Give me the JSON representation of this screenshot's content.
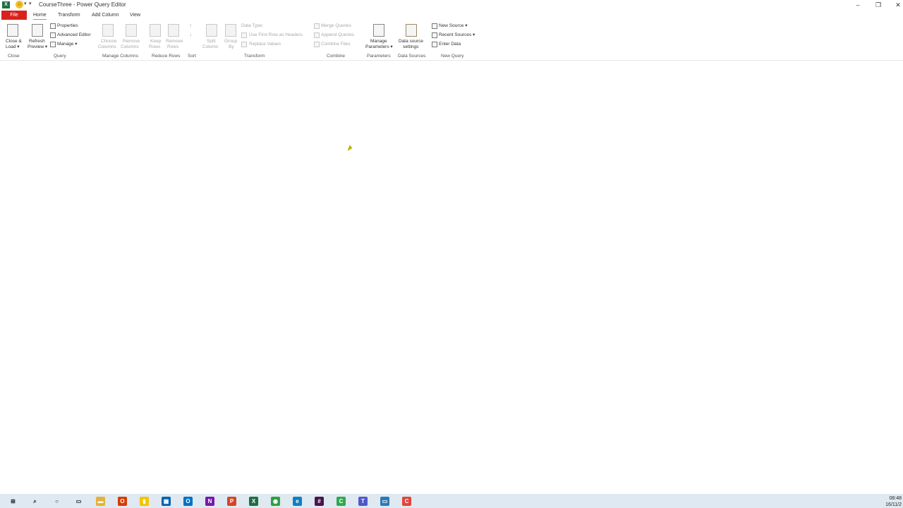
{
  "window": {
    "title": "CourseThree - Power Query Editor",
    "quick_access": {
      "excel_icon": "excel-icon",
      "smiley_icon": "smiley-icon",
      "dropdown_glyph": "▾"
    },
    "controls": {
      "minimize": "–",
      "restore": "❐",
      "close": "✕"
    }
  },
  "tabs": [
    {
      "label": "File",
      "active": false
    },
    {
      "label": "Home",
      "active": true
    },
    {
      "label": "Transform",
      "active": false
    },
    {
      "label": "Add Column",
      "active": false
    },
    {
      "label": "View",
      "active": false
    }
  ],
  "ribbon": {
    "close": {
      "close_load_l1": "Close &",
      "close_load_l2": "Load ▾",
      "group": "Close"
    },
    "query": {
      "refresh_l1": "Refresh",
      "refresh_l2": "Preview ▾",
      "properties": "Properties",
      "advanced_editor": "Advanced Editor",
      "manage": "Manage ▾",
      "group": "Query"
    },
    "manage_columns": {
      "choose_l1": "Choose",
      "choose_l2": "Columns",
      "remove_l1": "Remove",
      "remove_l2": "Columns",
      "group": "Manage Columns"
    },
    "reduce_rows": {
      "keep_l1": "Keep",
      "keep_l2": "Rows",
      "remove_l1": "Remove",
      "remove_l2": "Rows",
      "group": "Reduce Rows"
    },
    "sort": {
      "group": "Sort"
    },
    "transform": {
      "split_l1": "Split",
      "split_l2": "Column",
      "group_l1": "Group",
      "group_l2": "By",
      "data_type": "Data Type:",
      "first_row": "Use First Row as Headers",
      "replace_values": "Replace Values",
      "group": "Transform"
    },
    "combine": {
      "merge": "Merge Queries",
      "append": "Append Queries",
      "combine_files": "Combine Files",
      "group": "Combine"
    },
    "parameters": {
      "manage_l1": "Manage",
      "manage_l2": "Parameters ▾",
      "group": "Parameters"
    },
    "data_sources": {
      "settings_l1": "Data source",
      "settings_l2": "settings",
      "group": "Data Sources"
    },
    "new_query": {
      "new_source": "New Source ▾",
      "recent_sources": "Recent Sources ▾",
      "enter_data": "Enter Data",
      "group": "New Query"
    }
  },
  "taskbar": {
    "apps": [
      {
        "name": "start-icon",
        "glyph": "⊞",
        "color": "#1a1a1a"
      },
      {
        "name": "search-icon",
        "glyph": "⌕",
        "color": "#1a1a1a"
      },
      {
        "name": "cortana-icon",
        "glyph": "○",
        "color": "#1a1a1a"
      },
      {
        "name": "task-view-icon",
        "glyph": "▭",
        "color": "#1a1a1a"
      },
      {
        "name": "file-explorer-icon",
        "glyph": "▬",
        "color": "#e5b13a"
      },
      {
        "name": "office-icon",
        "glyph": "O",
        "color": "#d83b01"
      },
      {
        "name": "sticky-notes-icon",
        "glyph": "▮",
        "color": "#f5c400"
      },
      {
        "name": "calculator-icon",
        "glyph": "▦",
        "color": "#0063b1"
      },
      {
        "name": "outlook-icon",
        "glyph": "O",
        "color": "#0072c6"
      },
      {
        "name": "onenote-icon",
        "glyph": "N",
        "color": "#7719aa"
      },
      {
        "name": "powerpoint-icon",
        "glyph": "P",
        "color": "#d24726"
      },
      {
        "name": "excel-icon",
        "glyph": "X",
        "color": "#1d6f42"
      },
      {
        "name": "chrome-icon",
        "glyph": "◉",
        "color": "#2f9e44"
      },
      {
        "name": "edge-icon",
        "glyph": "e",
        "color": "#0f7fc4"
      },
      {
        "name": "slack-icon",
        "glyph": "#",
        "color": "#4a154b"
      },
      {
        "name": "camtasia-icon",
        "glyph": "C",
        "color": "#2fa84f"
      },
      {
        "name": "teams-icon",
        "glyph": "T",
        "color": "#5059c9"
      },
      {
        "name": "remote-desktop-icon",
        "glyph": "▭",
        "color": "#2a7ab8"
      },
      {
        "name": "camtasia-recorder-icon",
        "glyph": "C",
        "color": "#e0453b"
      }
    ],
    "clock_time": "08:48",
    "clock_date": "16/11/2"
  },
  "colors": {
    "file_tab": "#d8231d",
    "taskbar": "#dfe9f1",
    "cursor": "#b8b000"
  }
}
